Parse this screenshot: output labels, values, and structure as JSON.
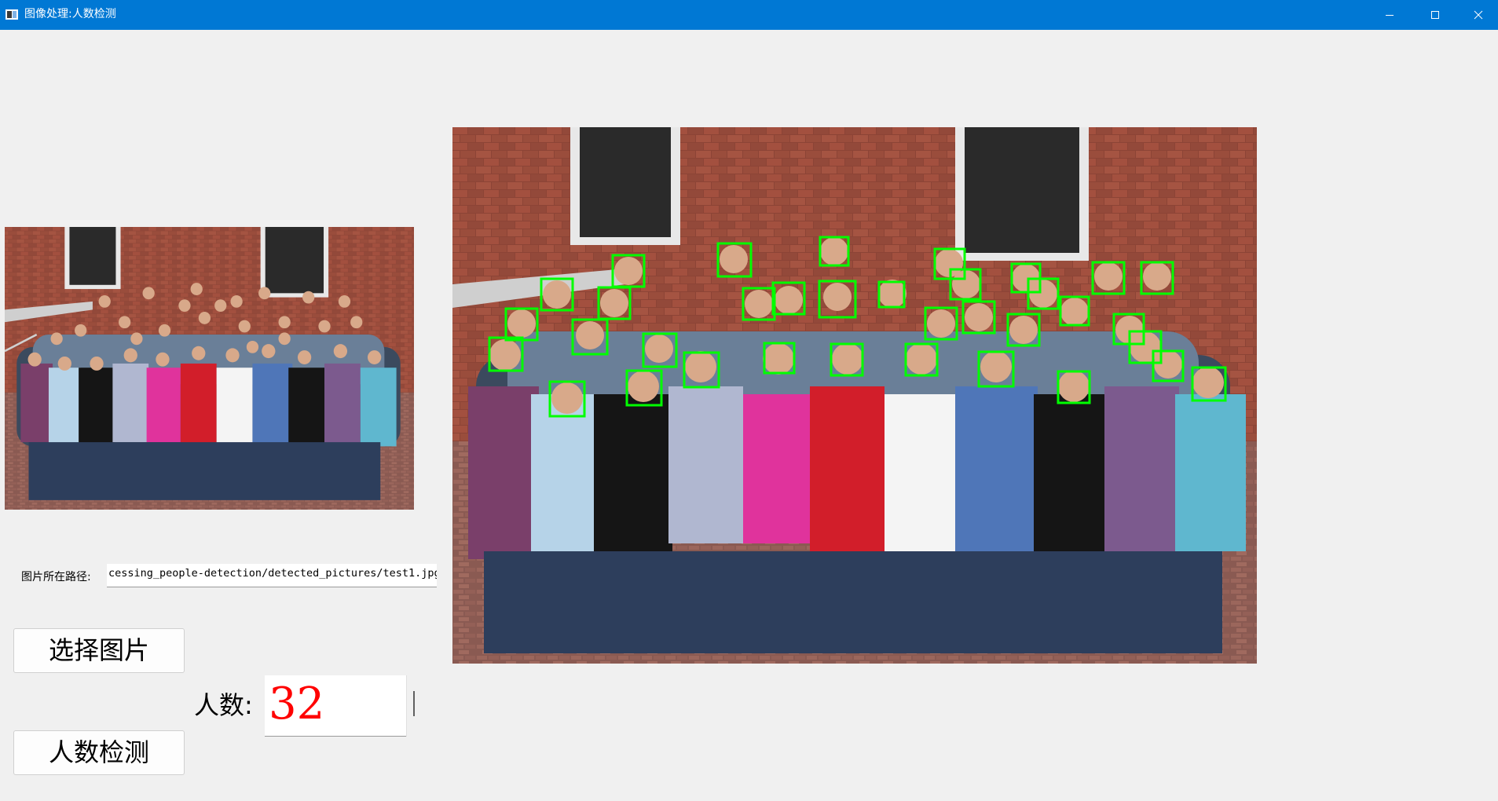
{
  "window": {
    "title": "图像处理:人数检测",
    "icon": "app-window-icon",
    "controls": [
      "minimize-icon",
      "maximize-icon",
      "close-icon"
    ]
  },
  "path": {
    "label": "图片所在路径:",
    "value": "cessing_people-detection/detected_pictures/test1.jpg"
  },
  "buttons": {
    "select": "选择图片",
    "detect": "人数检测"
  },
  "count": {
    "label": "人数:",
    "value": "32",
    "color": "#ff0000"
  },
  "colors": {
    "titlebar": "#0078d4",
    "detection_box": "#00ff00"
  }
}
